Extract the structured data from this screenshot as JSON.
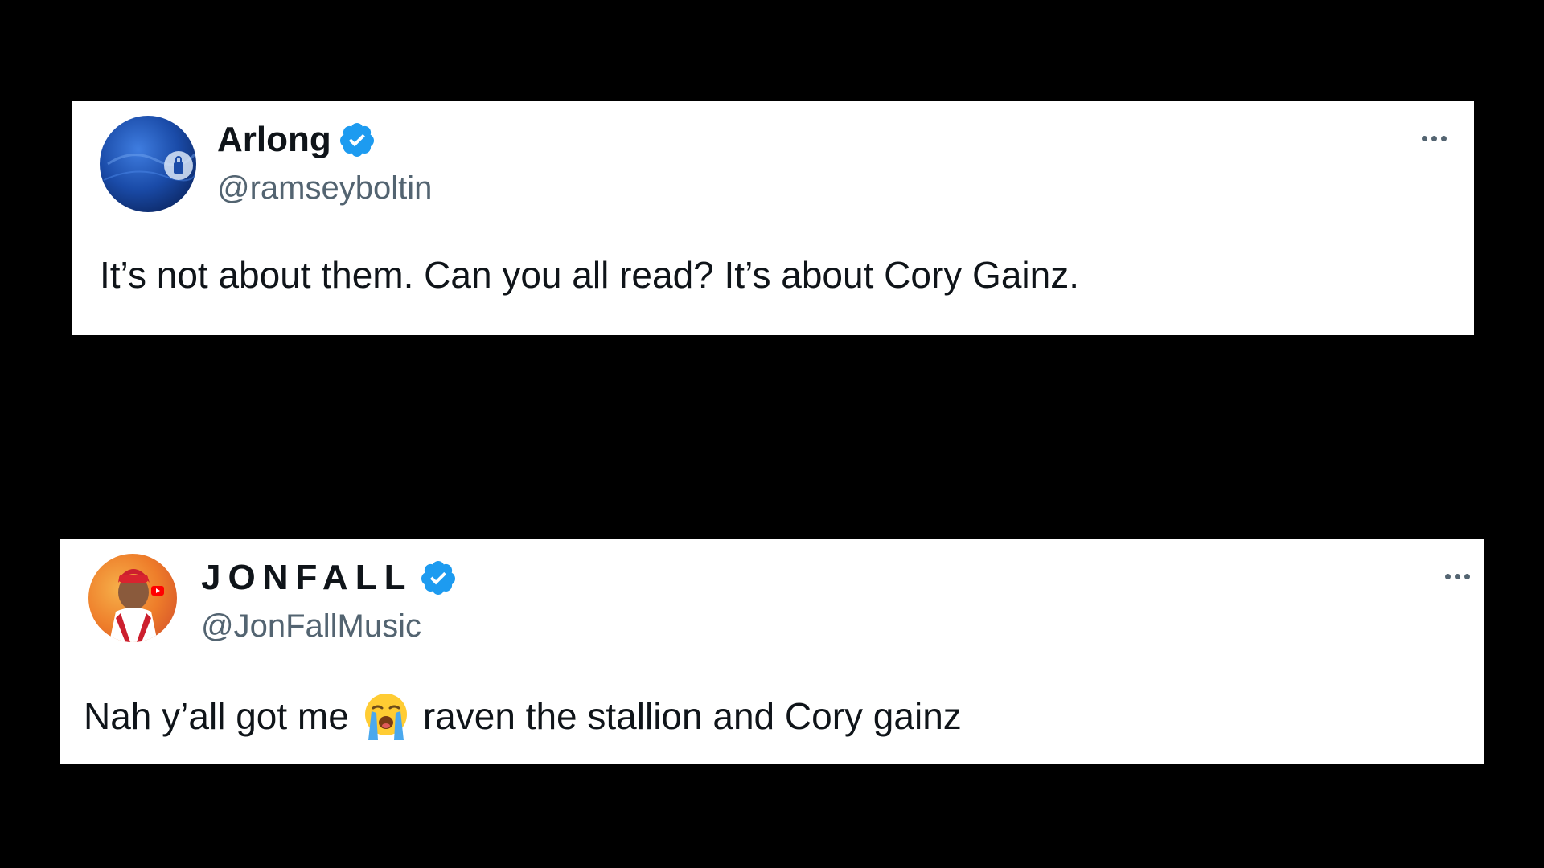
{
  "tweets": [
    {
      "display_name": "Arlong",
      "handle": "@ramseyboltin",
      "verified": true,
      "text": "It’s not about them. Can you all read? It’s about Cory Gainz."
    },
    {
      "display_name": "JONFALL",
      "handle": "@JonFallMusic",
      "verified": true,
      "text_before_emoji": "Nah y’all got me",
      "emoji": "loudly-crying-face-icon",
      "text_after_emoji": "raven the stallion and Cory gainz"
    }
  ],
  "colors": {
    "background": "#000000",
    "card": "#ffffff",
    "name": "#0f1419",
    "handle": "#536471",
    "verified": "#1d9bf0"
  }
}
